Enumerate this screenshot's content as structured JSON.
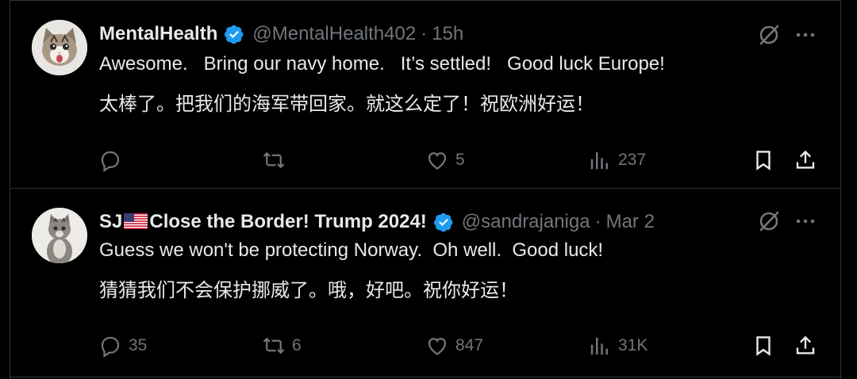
{
  "tweets": [
    {
      "name": "MentalHealth",
      "handle": "@MentalHealth402",
      "time": "15h",
      "text_en": "Awesome.   Bring our navy home.   It’s settled!   Good luck Europe!",
      "text_zh": "太棒了。把我们的海军带回家。就这么定了！祝欧洲好运！",
      "replies": "",
      "reposts": "",
      "likes": "5",
      "views": "237",
      "avatar_icon": "cat-kitten-avatar"
    },
    {
      "name_pre": "SJ",
      "name_post": "Close the Border! Trump 2024!",
      "handle": "@sandrajaniga",
      "time": "Mar 2",
      "text_en": "Guess we won't be protecting Norway.  Oh well.  Good luck!",
      "text_zh": "猜猜我们不会保护挪威了。哦，好吧。祝你好运！",
      "replies": "35",
      "reposts": "6",
      "likes": "847",
      "views": "31K",
      "avatar_icon": "cat-sitting-avatar",
      "flag_icon": "us-flag-icon"
    }
  ],
  "colors": {
    "background": "#000000",
    "text": "#e7e9ea",
    "muted": "#71767b",
    "verified": "#1d9bf0",
    "border": "#2f3336"
  }
}
